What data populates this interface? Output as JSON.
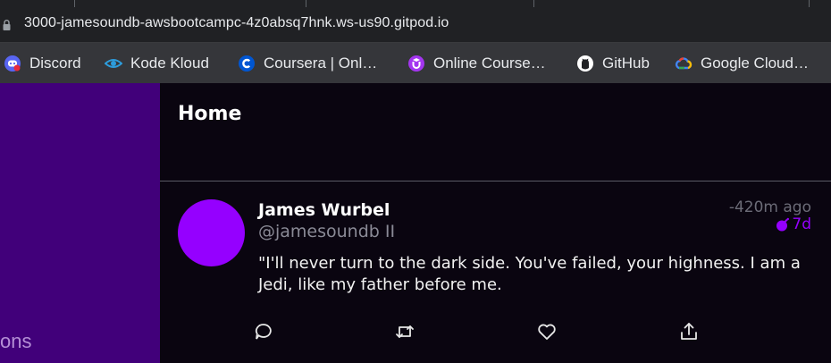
{
  "browser": {
    "url": "3000-jamesoundb-awsbootcampc-4z0absq7hnk.ws-us90.gitpod.io",
    "bookmarks": [
      {
        "label": "Discord",
        "icon": "discord-icon",
        "color": "#5865f2"
      },
      {
        "label": "Kode Kloud",
        "icon": "kodekloud-icon",
        "color": "#2d9cdb"
      },
      {
        "label": "Coursera | Onl…",
        "icon": "coursera-icon",
        "color": "#0056d2"
      },
      {
        "label": "Online Course…",
        "icon": "udemy-icon",
        "color": "#a435f0"
      },
      {
        "label": "GitHub",
        "icon": "github-icon",
        "color": "#ffffff"
      },
      {
        "label": "Google Cloud…",
        "icon": "google-cloud-icon",
        "color": "#4285f4"
      }
    ]
  },
  "sidebar": {
    "partial_label": "ons",
    "background": "#41007a"
  },
  "main": {
    "title": "Home"
  },
  "activity": {
    "display_name": "James Wurbel",
    "handle": "@jamesoundb II",
    "message": "\"I'll never turn to the dark side. You've failed, your highness. I am a Jedi, like my father before me.",
    "created_ago": "-420m ago",
    "expires_in": "7d",
    "avatar_color": "#9500ff",
    "accent_color": "#9500ff",
    "actions": [
      {
        "name": "reply",
        "icon": "reply-icon"
      },
      {
        "name": "repost",
        "icon": "repost-icon"
      },
      {
        "name": "like",
        "icon": "heart-icon"
      },
      {
        "name": "share",
        "icon": "share-icon"
      }
    ]
  }
}
